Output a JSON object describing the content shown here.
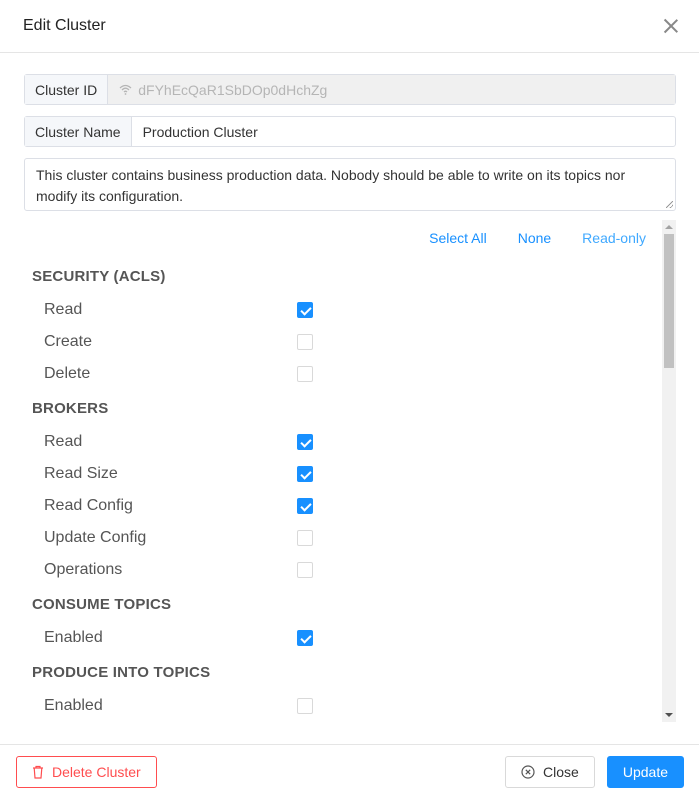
{
  "modal": {
    "title": "Edit Cluster"
  },
  "fields": {
    "cluster_id_label": "Cluster ID",
    "cluster_id_value": "dFYhEcQaR1SbDOp0dHchZg",
    "cluster_name_label": "Cluster Name",
    "cluster_name_value": "Production Cluster",
    "description": "This cluster contains business production data. Nobody should be able to write on its topics nor modify its configuration."
  },
  "quick_select": {
    "select_all": "Select All",
    "none": "None",
    "read_only": "Read-only"
  },
  "sections": [
    {
      "title": "SECURITY (ACLS)",
      "items": [
        {
          "label": "Read",
          "checked": true
        },
        {
          "label": "Create",
          "checked": false
        },
        {
          "label": "Delete",
          "checked": false
        }
      ]
    },
    {
      "title": "BROKERS",
      "items": [
        {
          "label": "Read",
          "checked": true
        },
        {
          "label": "Read Size",
          "checked": true
        },
        {
          "label": "Read Config",
          "checked": true
        },
        {
          "label": "Update Config",
          "checked": false
        },
        {
          "label": "Operations",
          "checked": false
        }
      ]
    },
    {
      "title": "CONSUME TOPICS",
      "items": [
        {
          "label": "Enabled",
          "checked": true
        }
      ]
    },
    {
      "title": "PRODUCE INTO TOPICS",
      "items": [
        {
          "label": "Enabled",
          "checked": false
        }
      ]
    }
  ],
  "footer": {
    "delete_label": "Delete Cluster",
    "close_label": "Close",
    "update_label": "Update"
  },
  "colors": {
    "primary": "#1890ff",
    "danger": "#ff4d4f"
  }
}
